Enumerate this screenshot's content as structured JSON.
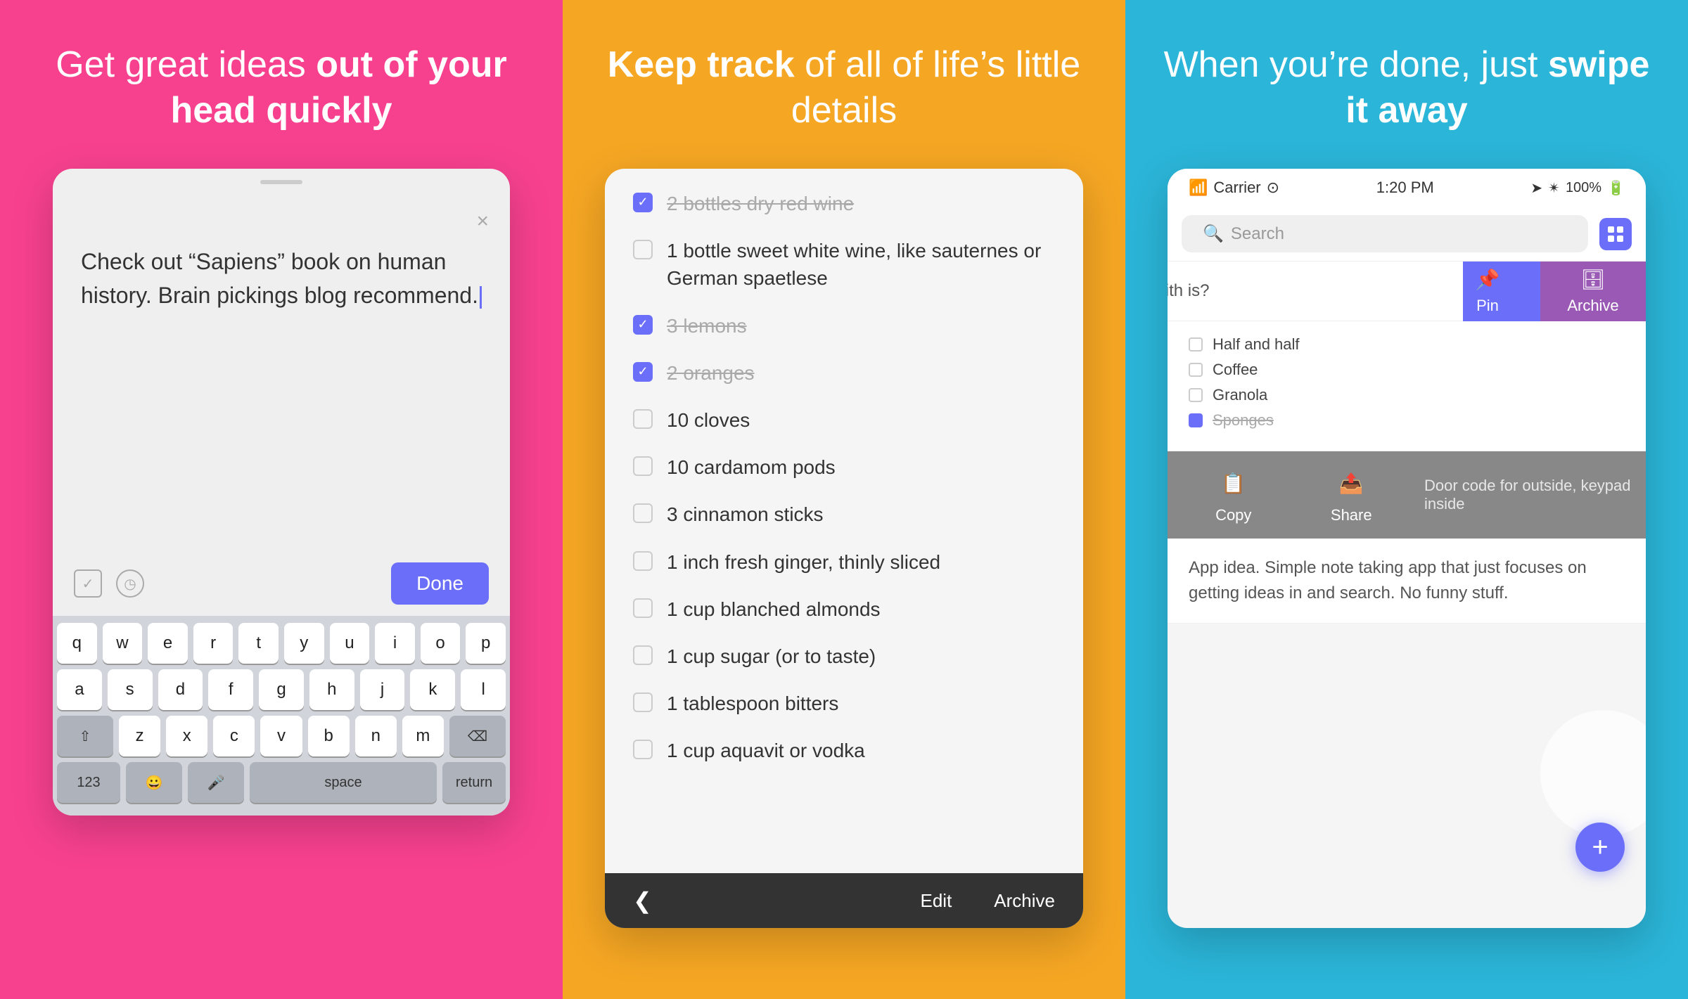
{
  "panel1": {
    "title_normal": "Get great ideas ",
    "title_bold": "out of your head quickly",
    "note_text": "Check out “Sapiens” book on human history. Brain pickings blog recommend.",
    "done_label": "Done",
    "close_label": "×",
    "keyboard_rows": [
      [
        "q",
        "w",
        "e",
        "r",
        "t",
        "y",
        "u",
        "i",
        "o",
        "p"
      ],
      [
        "a",
        "s",
        "d",
        "f",
        "g",
        "h",
        "j",
        "k",
        "l"
      ],
      [
        "⇧",
        "z",
        "x",
        "c",
        "v",
        "b",
        "n",
        "m",
        "⌫"
      ],
      [
        "123",
        "😀",
        "🎤",
        "space",
        "return"
      ]
    ]
  },
  "panel2": {
    "title_bold": "Keep track",
    "title_normal": " of all of life’s little details",
    "checklist": [
      {
        "checked": true,
        "text": "2 bottles dry red wine"
      },
      {
        "checked": false,
        "text": "1 bottle sweet white wine, like sauternes or German spaetlese"
      },
      {
        "checked": true,
        "text": "3 lemons"
      },
      {
        "checked": true,
        "text": "2 oranges"
      },
      {
        "checked": false,
        "text": "10 cloves"
      },
      {
        "checked": false,
        "text": "10 cardamom pods"
      },
      {
        "checked": false,
        "text": "3 cinnamon sticks"
      },
      {
        "checked": false,
        "text": "1 inch fresh ginger, thinly sliced"
      },
      {
        "checked": false,
        "text": "1 cup blanched almonds"
      },
      {
        "checked": false,
        "text": "1 cup sugar (or to taste)"
      },
      {
        "checked": false,
        "text": "1 tablespoon bitters"
      },
      {
        "checked": false,
        "text": "1 cup aquavit or vodka"
      }
    ],
    "nav": {
      "back": "❮",
      "edit": "Edit",
      "archive": "Archive"
    }
  },
  "panel3": {
    "title_normal": "When you’re done, just ",
    "title_bold": "swipe it away",
    "status_bar": {
      "signal": "..ll",
      "carrier": "Carrier",
      "wifi": "◎",
      "time": "1:20 PM",
      "location": "→",
      "bluetooth": "в",
      "battery": "100%"
    },
    "search_placeholder": "Search",
    "note1": {
      "text": "floors of a let floors with is?"
    },
    "swipe_actions": {
      "pin_label": "Pin",
      "archive_label": "Archive"
    },
    "checklist_note": {
      "items": [
        {
          "checked": false,
          "text": "Half and half"
        },
        {
          "checked": false,
          "text": "Coffee"
        },
        {
          "checked": false,
          "text": "Granola"
        },
        {
          "checked": true,
          "text": "Sponges"
        }
      ]
    },
    "bottom_actions": {
      "copy_label": "Copy",
      "share_label": "Share"
    },
    "floating_note": "Door code for outside, keypad inside",
    "app_idea_note": "App idea. Simple note taking app that just focuses on getting ideas in and search. No funny stuff.",
    "fab_label": "+"
  }
}
